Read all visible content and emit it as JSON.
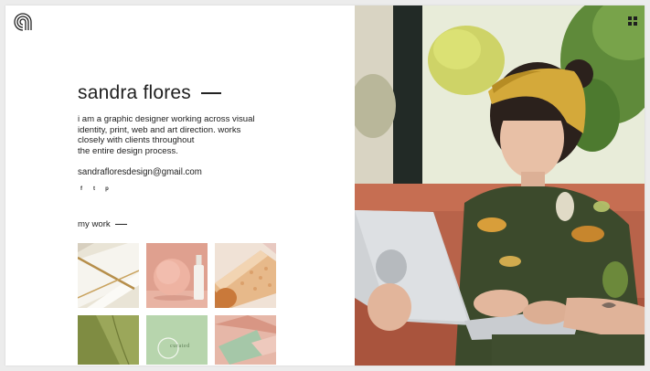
{
  "profile": {
    "name": "sandra flores",
    "bio_lines": [
      "i am a graphic designer working across visual",
      "identity, print, web and art direction. works",
      "closely with clients throughout",
      "the entire design process."
    ],
    "email": "sandrafloresdesign@gmail.com"
  },
  "social": {
    "facebook": "f",
    "twitter": "t",
    "pinterest": "p"
  },
  "work": {
    "heading": "my work",
    "tiles": [
      {
        "label": ""
      },
      {
        "label": ""
      },
      {
        "label": ""
      },
      {
        "label": ""
      },
      {
        "label": "curated"
      },
      {
        "label": ""
      }
    ]
  },
  "icons": {
    "logo": "logo-icon",
    "menu": "grid-menu-icon"
  },
  "colors": {
    "accent": "#d9a08f",
    "mustard": "#d4a93a",
    "sage": "#a9c99e",
    "text": "#1f1f1f"
  }
}
